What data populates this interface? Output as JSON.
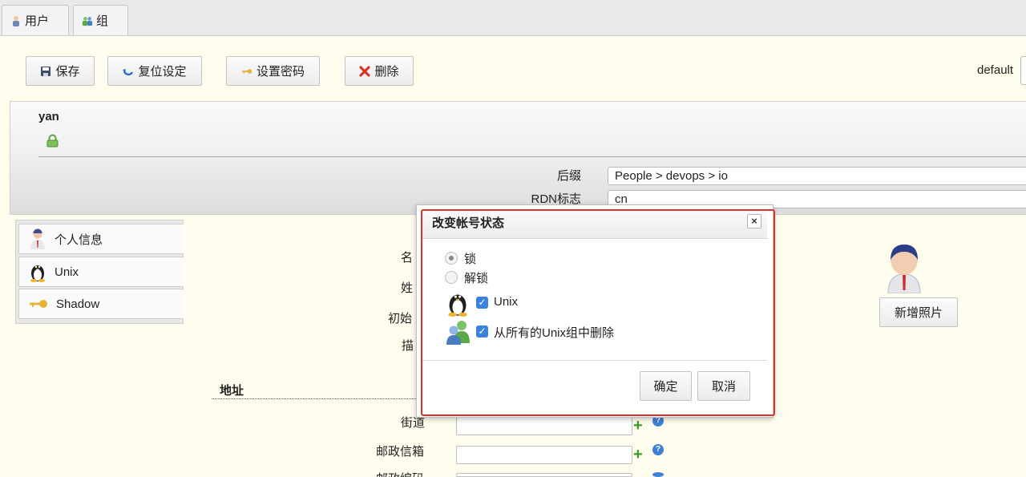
{
  "tabs": [
    {
      "label": "用户",
      "icon": "user-icon"
    },
    {
      "label": "组",
      "icon": "group-icon"
    }
  ],
  "toolbar": {
    "save": "保存",
    "reset": "复位设定",
    "set_password": "设置密码",
    "delete": "删除",
    "profile": "default"
  },
  "header": {
    "username": "yan",
    "suffix_label": "后缀",
    "suffix_value": "People > devops > io",
    "rdn_label": "RDN标志",
    "rdn_value": "cn"
  },
  "side_tabs": [
    "个人信息",
    "Unix",
    "Shadow"
  ],
  "form": {
    "labels_partial": [
      "名",
      "姓",
      "初始",
      "描"
    ],
    "section_address": "地址",
    "street": "街道",
    "postbox": "邮政信箱",
    "postcode_partial": "邮政编码"
  },
  "photo": {
    "add_label": "新增照片"
  },
  "dialog": {
    "title": "改变帐号状态",
    "lock": "锁",
    "unlock": "解锁",
    "unix": "Unix",
    "remove_groups": "从所有的Unix组中删除",
    "ok": "确定",
    "cancel": "取消",
    "lock_selected": true,
    "unix_checked": true,
    "remove_groups_checked": true
  }
}
